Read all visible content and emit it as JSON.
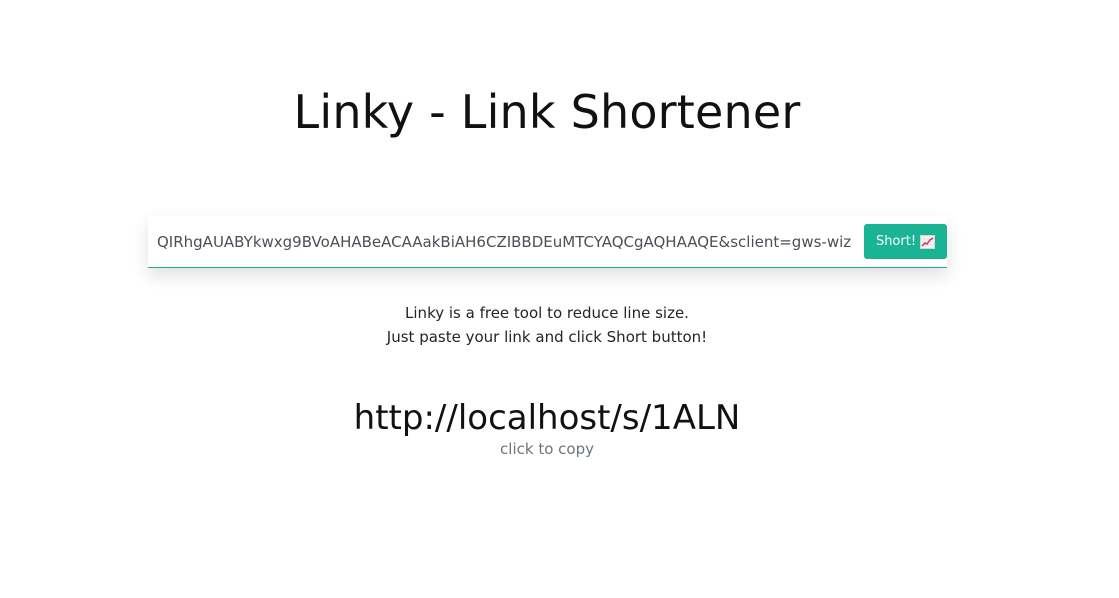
{
  "header": {
    "title": "Linky - Link Shortener"
  },
  "form": {
    "url_value": "QIRhgAUABYkwxg9BVoAHABeACAAakBiAH6CZIBBDEuMTCYAQCgAQHAAQE&sclient=gws-wiz",
    "button_label": "Short!",
    "button_icon": "chart-increasing-icon",
    "accent_color": "#1ab394"
  },
  "description": {
    "line1": "Linky is a free tool to reduce line size.",
    "line2": "Just paste your link and click Short button!"
  },
  "result": {
    "short_url": "http://localhost/s/1ALN",
    "copy_hint": "click to copy"
  }
}
